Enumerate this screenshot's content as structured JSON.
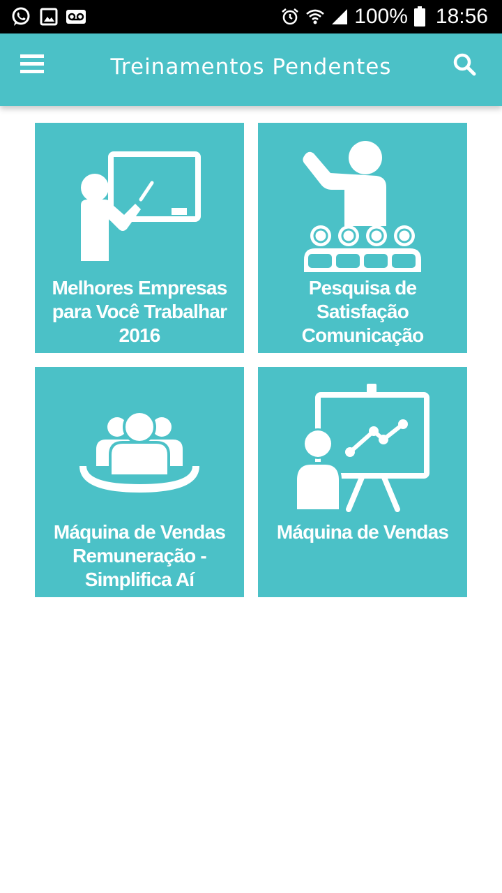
{
  "status_bar": {
    "battery": "100%",
    "time": "18:56",
    "icons_left": [
      "whatsapp-icon",
      "image-icon",
      "voicemail-icon"
    ],
    "icons_right": [
      "alarm-icon",
      "wifi-icon",
      "signal-icon",
      "battery-icon"
    ]
  },
  "app_bar": {
    "title": "Treinamentos Pendentes",
    "menu_icon": "menu-icon",
    "search_icon": "search-icon"
  },
  "trainings": [
    {
      "title": "Melhores Empresas para Você Trabalhar 2016",
      "icon": "teacher-whiteboard-icon"
    },
    {
      "title": "Pesquisa de Satisfação Comunicação",
      "icon": "presenter-audience-icon"
    },
    {
      "title": "Máquina de Vendas Remuneração - Simplifica Aí",
      "icon": "meeting-group-icon"
    },
    {
      "title": "Máquina de Vendas",
      "icon": "presentation-chart-icon"
    }
  ],
  "colors": {
    "accent": "#4bc1c7",
    "status_bar": "#000000",
    "background": "#ffffff",
    "text_on_accent": "#ffffff"
  }
}
